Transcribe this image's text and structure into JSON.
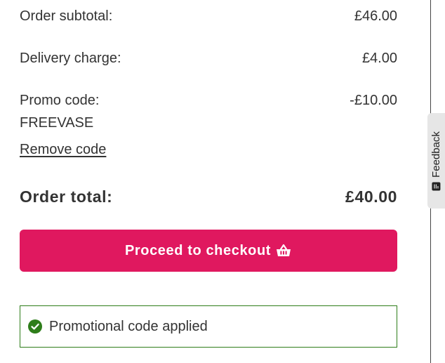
{
  "summary": {
    "subtotal_label": "Order subtotal:",
    "subtotal_value": "£46.00",
    "delivery_label": "Delivery charge:",
    "delivery_value": "£4.00",
    "promo_label": "Promo code:",
    "promo_value": "-£10.00",
    "promo_code": "FREEVASE",
    "remove_code_label": "Remove code",
    "total_label": "Order total:",
    "total_value": "£40.00"
  },
  "checkout": {
    "label": "Proceed to checkout",
    "icon": "basket-icon",
    "color": "#e0185f"
  },
  "notice": {
    "text": "Promotional code applied",
    "icon": "check-circle-icon",
    "color": "#2e7d1a"
  },
  "feedback": {
    "label": "Feedback",
    "icon": "feedback-icon"
  }
}
